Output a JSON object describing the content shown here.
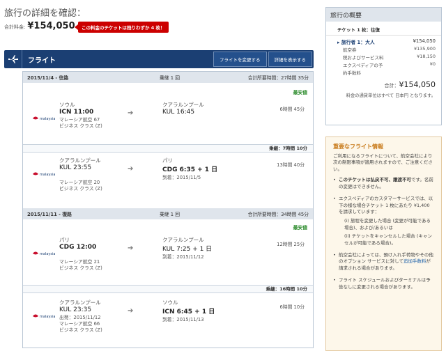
{
  "page": {
    "title": "旅行の詳細を確認：",
    "total_label": "合計料金:",
    "total_price": "¥154,050",
    "alert": "この料金のチケットは残りわずか 4 枚！"
  },
  "flight_header": {
    "title": "フライト",
    "change_button": "フライトを変更する",
    "details_button": "詳細を表示する"
  },
  "legs": [
    {
      "date": "2015/11/4 - 往路",
      "stops": "乗継 1 回",
      "duration": "合計所要時間：27時間 35分",
      "badge": "最安値",
      "segments": [
        {
          "from_city": "ソウル",
          "from_time": "ICN 11:00",
          "to_city": "クアラルンプール",
          "to_time": "KUL 16:45",
          "airline": "マレーシア航空 67",
          "cabin": "ビジネス クラス (Z)",
          "duration": "6時間 45分"
        },
        {
          "from_city": "クアラルンプール",
          "from_time": "KUL 23:55",
          "to_city": "パリ",
          "to_time": "CDG 6:35 + 1 日",
          "arrive": "到着：2015/11/5",
          "airline": "マレーシア航空 20",
          "cabin": "ビジネス クラス (Z)",
          "duration": "13時間 40分"
        }
      ],
      "layover": "乗継：7時間 10分"
    },
    {
      "date": "2015/11/11 - 復路",
      "stops": "乗継 1 回",
      "duration": "合計所要時間：34時間 45分",
      "badge": "最安値",
      "segments": [
        {
          "from_city": "パリ",
          "from_time": "CDG 12:00",
          "to_city": "クアラルンプール",
          "to_time": "KUL 7:25 + 1 日",
          "arrive": "到着：2015/11/12",
          "airline": "マレーシア航空 21",
          "cabin": "ビジネス クラス (Z)",
          "duration": "12時間 25分"
        },
        {
          "from_city": "クアラルンプール",
          "from_time": "KUL 23:35",
          "depart": "出発：2015/11/12",
          "to_city": "ソウル",
          "to_time": "ICN 6:45 + 1 日",
          "arrive": "到着：2015/11/13",
          "airline": "マレーシア航空 66",
          "cabin": "ビジネス クラス (Z)",
          "duration": "6時間 10分"
        }
      ],
      "layover": "乗継：16時間 10分"
    }
  ],
  "summary": {
    "title": "旅行の概要",
    "ticket": "チケット 1 枚：往復",
    "traveler": "旅行者 1：大人",
    "traveler_price": "¥154,050",
    "rows": [
      {
        "label": "航空券",
        "value": "¥135,900"
      },
      {
        "label": "税およびサービス料",
        "value": "¥18,150"
      },
      {
        "label": "エクスペディアの予",
        "value": "¥0"
      },
      {
        "label": "約手数料",
        "value": ""
      }
    ],
    "total_label": "合計：",
    "total": "¥154,050",
    "note": "料金の通貨単位はすべて 日本円 となります。"
  },
  "important": {
    "title": "重要なフライト情報",
    "intro": "ご利用になるフライトについて、航空会社により次の制限事項が適用されますので、ご注意ください。",
    "item1_bold": "このチケットは払戻不可、譲渡不可",
    "item1_rest": "です。名前の変更はできません。",
    "item2": "エクスペディアのカスタマーサービスでは、以下の様な場合チケット 1 枚にあたり ¥1,400 を請求しています：",
    "item2_sub1": "(i) 旅程を変更した場合 (変更が可能である場合)、および/あるいは",
    "item2_sub2": "(ii) チケットをキャンセルした場合 (キャンセルが可能である場合)。",
    "item3_a": "航空会社によっては、預け入れ手荷物やその他のオプション サービスに対して",
    "item3_link": "追加手数料",
    "item3_b": "が請求される場合があります。",
    "item4": "フライト スケジュールおよびターミナルは予告なしに変更される場合があります。"
  }
}
